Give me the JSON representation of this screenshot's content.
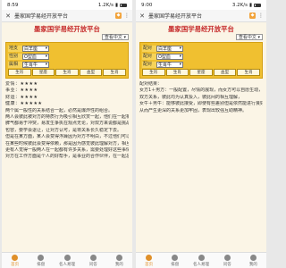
{
  "colors": {
    "accent": "#e0902a",
    "title_red": "#c62d2d",
    "form_yellow": "#f0c030",
    "page_bg": "#fbf5e6"
  },
  "left": {
    "status": {
      "time": "8:59",
      "net": "1.2K/s"
    },
    "tab": {
      "close": "✕",
      "title": "墨家国学易经开放平台",
      "more": "⋮"
    },
    "site_title": "墨家国学易经开放平台",
    "guide": "查看中文 ▾",
    "form": {
      "rows": [
        {
          "label": "地支",
          "value": "白羊座"
        },
        {
          "label": "性别",
          "value": "O型血"
        },
        {
          "label": "属相",
          "value": "生肖牛"
        }
      ],
      "buttons": [
        "生肖",
        "星座",
        "生肖",
        "血型",
        "生肖"
      ]
    },
    "results": [
      "爱情：★★★★",
      "事业：★★★★",
      "财运：★★★★",
      "健康：★★★★★",
      "两个属一般性的关系结合一起，必然是爆炸性的组合。",
      "两人会彼此被对方的特质行为吸引相互欣赏一起，他们在一起相得益彰，而双方",
      "脾气都易于冲突，易发生争执在观点无论，对双方来说都是挑战，有时需要互相",
      "包容，要学会退让，让对方认可，是将关系长久稳定下去。",
      "但是在某方面，某人会变得浮躁因为对方不明白，不过他们可以经营管理。",
      "在某些时候彼此会变得依赖，那是因为感觉彼此理解对方，相互需要对方，",
      "更有人觉得一般两人在一起都有许多关系，需要处理好这些事情，保持良好关系。",
      "对方在工作方面是个人的好帮手，是事业的合作伙伴，在一起总能完成目标。"
    ],
    "nav": [
      "首页",
      "排盘",
      "名人易理",
      "问答",
      "我的"
    ]
  },
  "right": {
    "status": {
      "time": "9:00",
      "net": "3.2K/s"
    },
    "tab": {
      "close": "✕",
      "title": "墨家国学易经开放平台",
      "more": "⋮"
    },
    "site_title": "墨家国学易经开放平台",
    "guide": "查看中文 ▾",
    "form": {
      "rows": [
        {
          "label": "配对",
          "value": "白羊座"
        },
        {
          "label": "配对",
          "value": "O型血"
        },
        {
          "label": "配对",
          "value": "生肖牛"
        }
      ],
      "buttons": [
        "生肖",
        "生肖",
        "星座",
        "血型",
        "生肖"
      ]
    },
    "results": [
      "配对结果：",
      "女方1＋男方：一般配置，尽情的展现，而女方可以自愿生动，",
      "双方关系，彼此均为认真投入，彼此间的相互理解，",
      "女牛＋男牛：能够彼此接受，即使有些差别但是依然能进行良好交流，",
      "从而产生更深的关系更加牢固，表现出较强互助精神。"
    ],
    "nav": [
      "首页",
      "排盘",
      "名人易理",
      "问答",
      "我的"
    ]
  }
}
